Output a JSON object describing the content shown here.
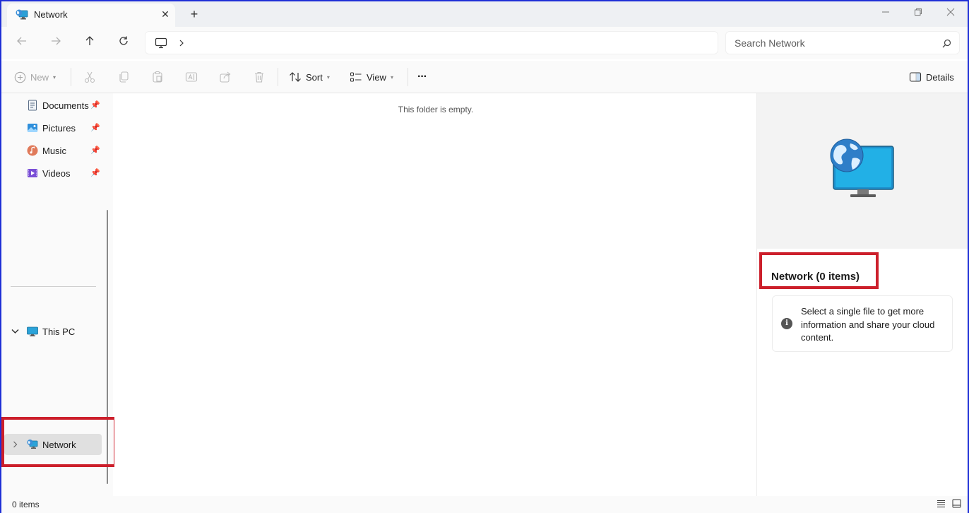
{
  "window": {
    "tab_title": "Network",
    "new_tab_symbol": "+",
    "close_tab_symbol": "✕"
  },
  "navigation": {
    "search_placeholder": "Search Network"
  },
  "commands": {
    "new_label": "New",
    "sort_label": "Sort",
    "view_label": "View",
    "more_label": "···",
    "details_label": "Details"
  },
  "sidebar": {
    "quick_access": [
      {
        "label": "Documents",
        "icon": "documents-icon",
        "pinned": true
      },
      {
        "label": "Pictures",
        "icon": "pictures-icon",
        "pinned": true
      },
      {
        "label": "Music",
        "icon": "music-icon",
        "pinned": true
      },
      {
        "label": "Videos",
        "icon": "videos-icon",
        "pinned": true
      }
    ],
    "this_pc_label": "This PC",
    "network_label": "Network"
  },
  "content": {
    "empty_message": "This folder is empty."
  },
  "details": {
    "title": "Network (0 items)",
    "info_message": "Select a single file to get more information and share your cloud content."
  },
  "status": {
    "item_count": "0 items"
  },
  "colors": {
    "highlight": "#cc1f2b",
    "frame": "#1f2fd6"
  }
}
